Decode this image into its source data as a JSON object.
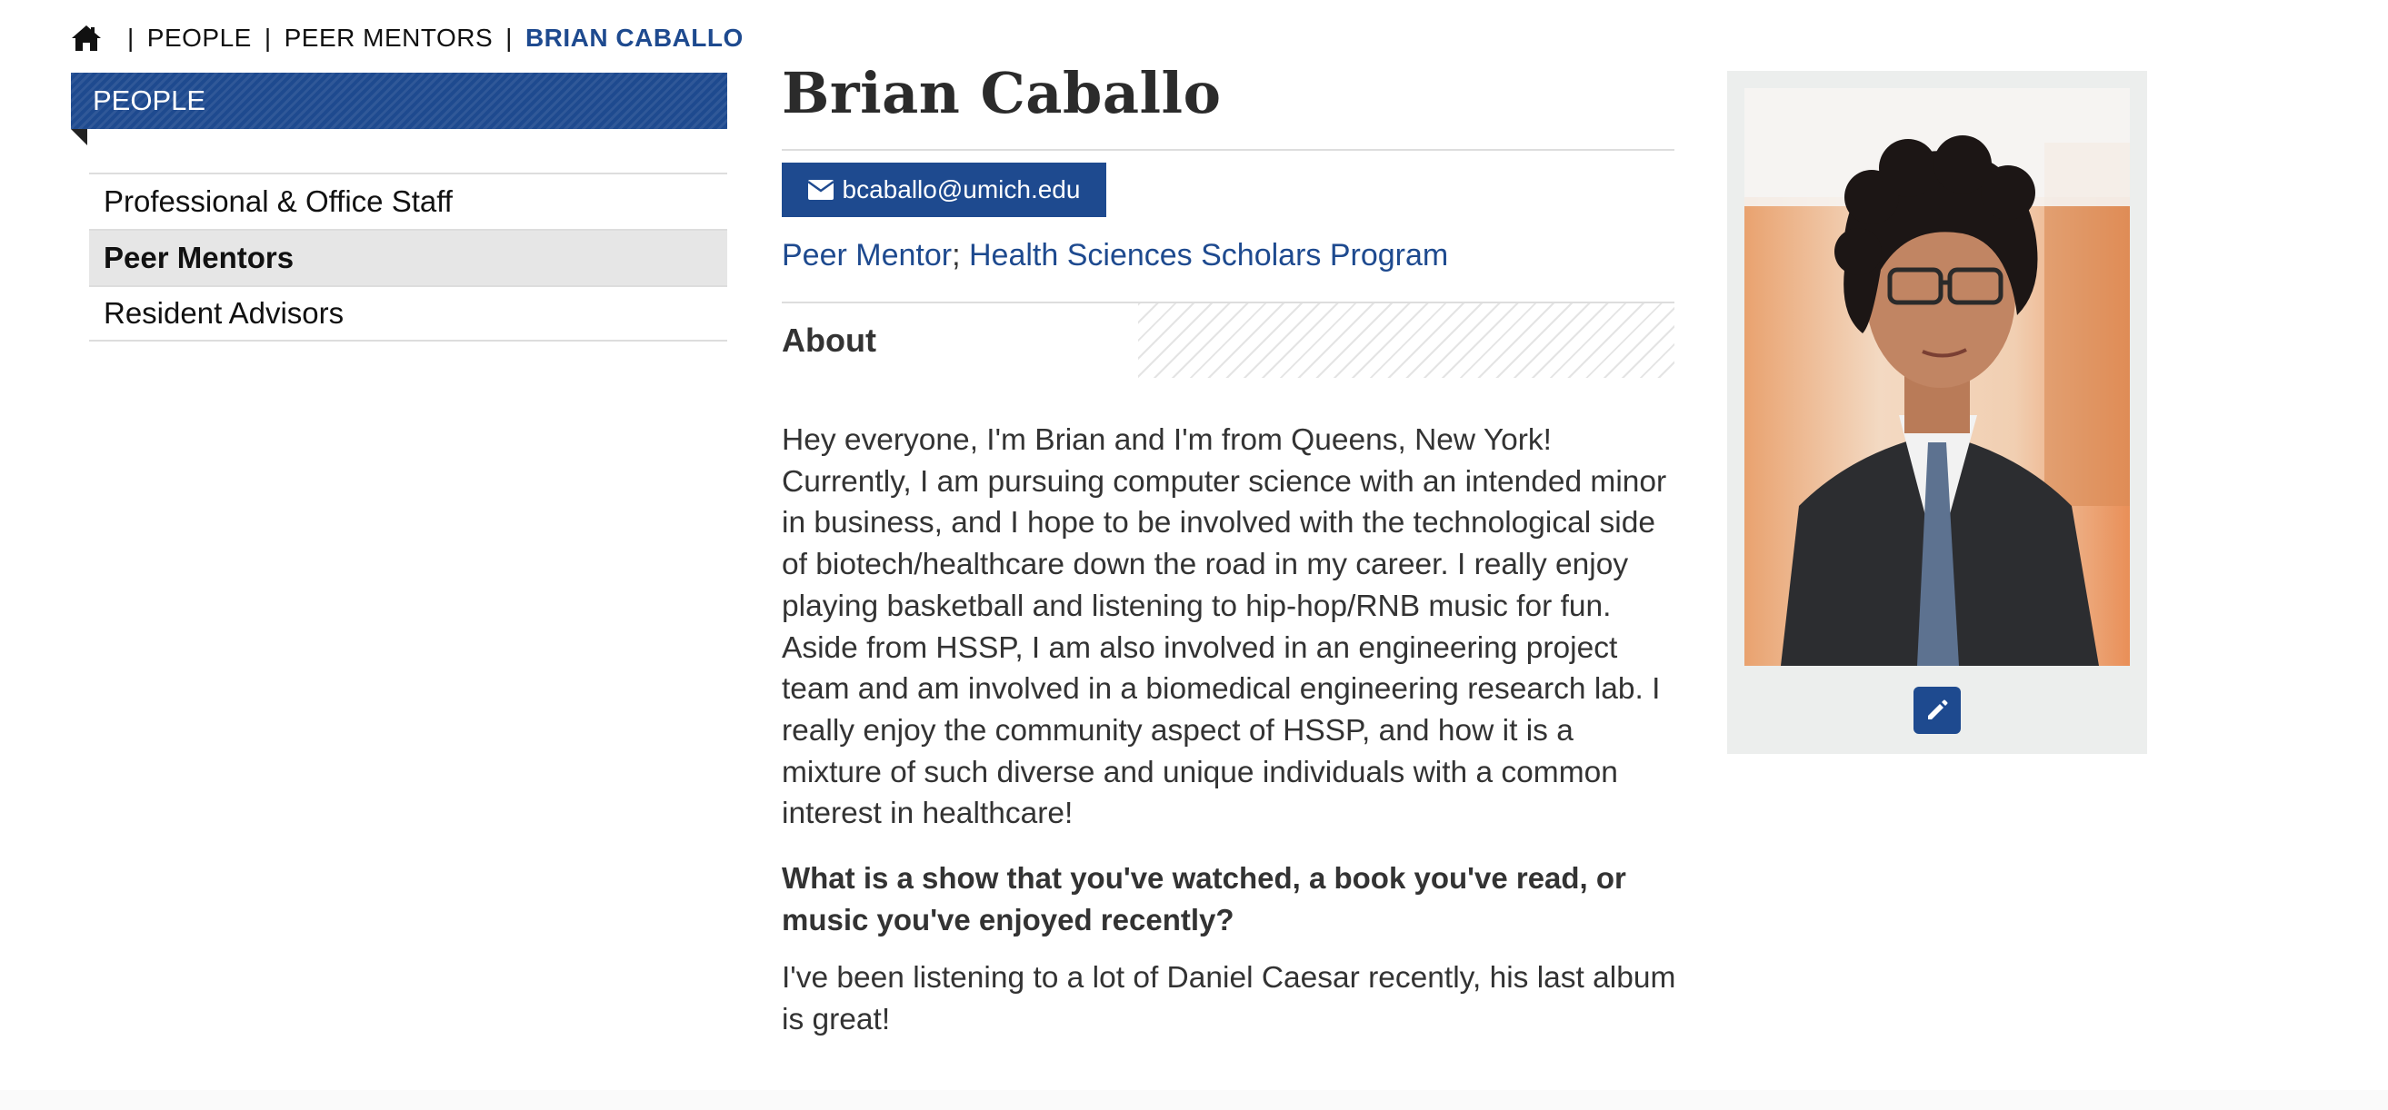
{
  "breadcrumb": {
    "items": [
      "PEOPLE",
      "PEER MENTORS"
    ],
    "current": "BRIAN CABALLO"
  },
  "sidebar": {
    "heading": "PEOPLE",
    "items": [
      {
        "label": "Professional & Office Staff",
        "active": false
      },
      {
        "label": "Peer Mentors",
        "active": true
      },
      {
        "label": "Resident Advisors",
        "active": false
      }
    ]
  },
  "profile": {
    "name": "Brian Caballo",
    "email": "bcaballo@umich.edu",
    "role": "Peer Mentor",
    "role_separator": ";",
    "program": "Health Sciences Scholars Program",
    "about_heading": "About",
    "bio": "Hey everyone, I'm Brian and I'm from Queens, New York! Currently, I am pursuing computer science with an intended minor in business, and I hope to be involved with the technological side of biotech/healthcare down the road in my career. I really enjoy playing basketball and listening to hip-hop/RNB music for fun. Aside from HSSP, I am also involved in an engineering project team and am involved in a biomedical engineering research lab. I really enjoy the community aspect of HSSP, and how it is a mixture of such diverse and unique individuals with a common interest in healthcare!",
    "question": "What is a show that you've watched, a book you've read, or music you've enjoyed recently?",
    "answer": "I've been listening to a lot of Daniel Caesar recently, his last album is great!"
  },
  "icons": {
    "home": "home-icon",
    "email": "envelope-icon",
    "edit": "pencil-icon"
  },
  "colors": {
    "brand_blue": "#1e4a8f",
    "active_bg": "#e6e6e6",
    "card_bg": "#eceeed"
  }
}
